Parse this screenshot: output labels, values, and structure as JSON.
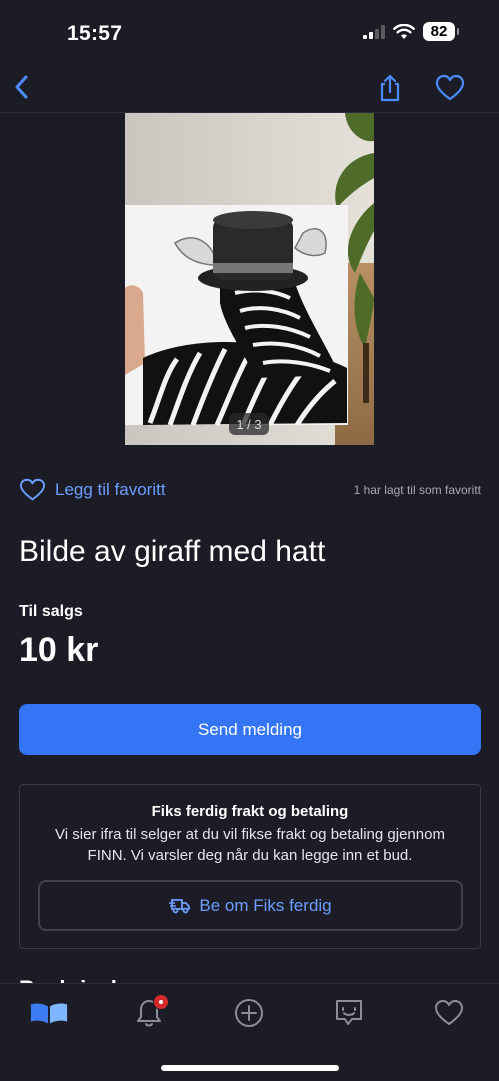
{
  "status_bar": {
    "time": "15:57",
    "battery": "82"
  },
  "navbar": {
    "back": "back-icon",
    "share": "share-icon",
    "favorite": "heart-icon"
  },
  "gallery": {
    "counter": "1 / 3"
  },
  "favorite": {
    "label": "Legg til favoritt",
    "count_text": "1 har lagt til som favoritt"
  },
  "listing": {
    "title": "Bilde av giraff med hatt",
    "status": "Til salgs",
    "price": "10 kr"
  },
  "actions": {
    "send_label": "Send melding"
  },
  "fiks_ferdig": {
    "title": "Fiks ferdig frakt og betaling",
    "body": "Vi sier ifra til selger at du vil fikse frakt og betaling gjennom FINN. Vi varsler deg når du kan legge inn et bud.",
    "button_label": "Be om Fiks ferdig"
  },
  "peek_text": "Beskrivelse",
  "tabbar": {
    "items": [
      "home-icon",
      "notifications-icon",
      "new-ad-icon",
      "messages-icon",
      "favorites-icon"
    ]
  },
  "colors": {
    "accent": "#3475f5",
    "link": "#6d9eff",
    "background": "#1b1c25",
    "badge": "#d62a2a"
  }
}
